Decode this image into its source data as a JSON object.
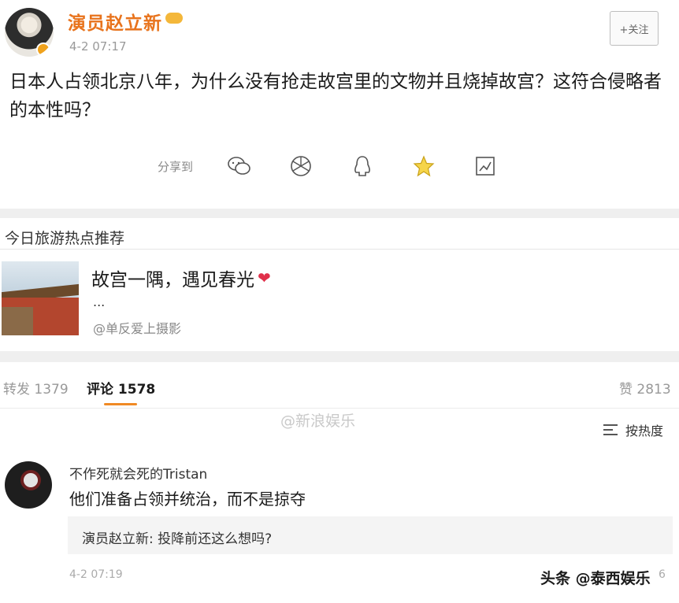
{
  "post": {
    "author": "演员赵立新",
    "time": "4-2 07:17",
    "follow_label": "+关注",
    "text": "日本人占领北京八年，为什么没有抢走故宫里的文物并且烧掉故宫？这符合侵略者的本性吗？",
    "share_label": "分享到",
    "share_icons": [
      "wechat-icon",
      "moments-icon",
      "qq-icon",
      "qzone-star-icon",
      "weibo-card-icon"
    ]
  },
  "recommend": {
    "section_title": "今日旅游热点推荐",
    "headline": "故宫一隅，遇见春光",
    "heart": "❤",
    "ellipsis": "...",
    "source": "@单反爱上摄影"
  },
  "tabs": {
    "repost": "转发 1379",
    "comments": "评论 1578",
    "likes": "赞 2813"
  },
  "watermark": "@新浪娱乐",
  "sort_label": "按热度",
  "comment": {
    "name": "不作死就会死的Tristan",
    "text": "他们准备占领并统治，而不是掠夺",
    "reply": "演员赵立新: 投降前还这么想吗?",
    "time": "4-2 07:19",
    "count": "6"
  },
  "brand": "头条 @泰西娱乐",
  "colors": {
    "accent": "#f08a24",
    "author": "#e8731c",
    "divider": "#efefef"
  }
}
